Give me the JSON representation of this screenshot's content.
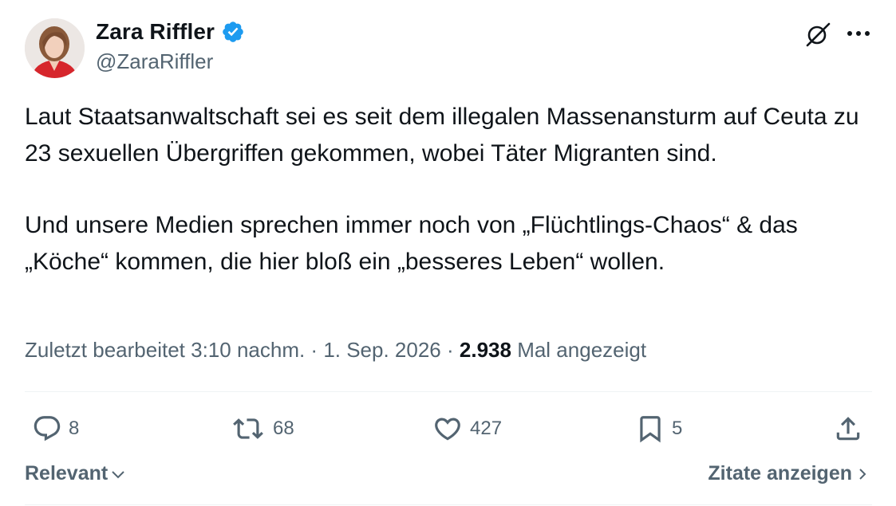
{
  "author": {
    "display_name": "Zara Riffler",
    "handle": "@ZaraRiffler",
    "verified": true,
    "badge_color": "#1d9bf0"
  },
  "tweet": {
    "paragraphs": [
      "Laut Staatsanwaltschaft sei es seit dem illegalen Massenansturm auf Ceuta zu 23 sexuellen Übergriffen gekommen, wobei Täter Migranten sind.",
      "Und unsere Medien sprechen immer noch von „Flüchtlings-Chaos“ & das „Köche“ kommen, die hier bloß ein „besseres Leben“ wollen."
    ]
  },
  "meta": {
    "edited_label": "Zuletzt bearbeitet 3:10 nachm.",
    "separator": " · ",
    "date": "1. Sep. 2026",
    "views_count": "2.938",
    "views_label": " Mal angezeigt"
  },
  "actions": {
    "replies": "8",
    "retweets": "68",
    "likes": "427",
    "bookmarks": "5"
  },
  "footer": {
    "sort_label": "Relevant",
    "quotes_label": "Zitate anzeigen"
  },
  "icons": {
    "grok": "grok-icon",
    "more": "more-horizontal-icon",
    "reply": "reply-icon",
    "retweet": "retweet-icon",
    "like": "heart-icon",
    "bookmark": "bookmark-icon",
    "share": "share-icon"
  },
  "colors": {
    "text_primary": "#0f1419",
    "text_secondary": "#536471",
    "divider": "#eff3f4",
    "accent": "#1d9bf0"
  }
}
